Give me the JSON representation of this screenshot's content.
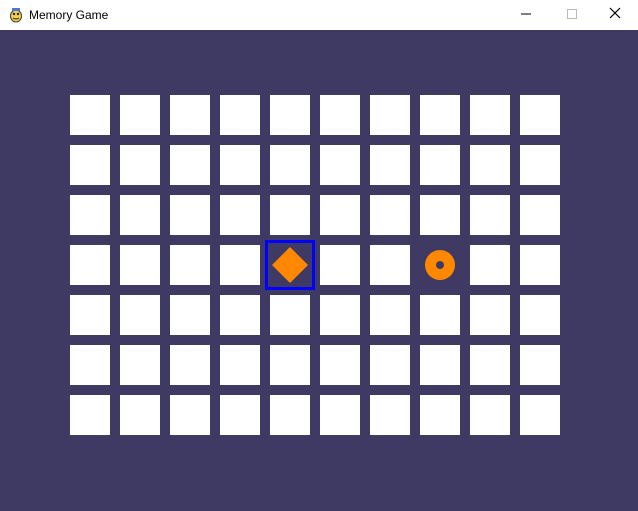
{
  "window": {
    "title": "Memory Game",
    "icon": "pygame-snake-icon",
    "controls": [
      "minimize-icon",
      "maximize-icon",
      "close-icon"
    ]
  },
  "game": {
    "background_color": "#3e3a63",
    "tile_color": "#ffffff",
    "highlight_color": "#0000ff",
    "board_columns": 10,
    "board_rows": 7,
    "revealed_tiles": [
      {
        "row": 3,
        "col": 4,
        "shape": "diamond",
        "color": "#ff8800",
        "selected": true
      },
      {
        "row": 3,
        "col": 7,
        "shape": "donut",
        "color": "#ff8800",
        "selected": false
      }
    ]
  }
}
